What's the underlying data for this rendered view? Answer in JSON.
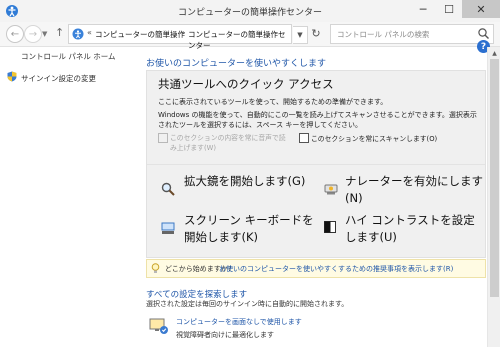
{
  "window": {
    "title": "コンピューターの簡単操作センター",
    "min_glyph": "─",
    "max_glyph": "☐",
    "close_glyph": "✕"
  },
  "nav": {
    "back_glyph": "←",
    "forward_glyph": "→",
    "history_glyph": "▼",
    "up_glyph": "↑",
    "breadcrumb_lead": "«",
    "breadcrumb": [
      "コンピューターの簡単操作",
      "コンピューターの簡単操作センター"
    ],
    "breadcrumb_sep": "›",
    "dropdown_glyph": "▼",
    "refresh_glyph": "↻",
    "search_placeholder": "コントロール パネルの検索"
  },
  "help_glyph": "?",
  "sidebar": {
    "items": [
      {
        "label": "コントロール パネル ホーム"
      },
      {
        "label": "サインイン設定の変更"
      }
    ]
  },
  "main": {
    "heading": "お使いのコンピューターを使いやすくします",
    "quick": {
      "heading": "共通ツールへのクイック アクセス",
      "description": "ここに表示されているツールを使って、開始するための準備ができます。",
      "body": "Windows の機能を使って、自動的にこの一覧を読み上げてスキャンさせることができます。選択表示されたツールを選択するには、スペース キーを押してください。",
      "checkbox_read_label": "このセクションの内容を常に音声で読み上げます(W)",
      "checkbox_scan_label": "このセクションを常にスキャンします(O)",
      "tools": [
        {
          "label": "拡大鏡を開始します(G)"
        },
        {
          "label": "ナレーターを有効にします(N)"
        },
        {
          "label": "スクリーン キーボードを開始します(K)"
        },
        {
          "label": "ハイ コントラストを設定します(U)"
        }
      ]
    },
    "info": {
      "prompt": "どこから始めますか?",
      "link": "お使いのコンピューターを使いやすくするための推奨事項を表示します(R)"
    },
    "explore": {
      "heading": "すべての設定を探索します",
      "description": "選択された設定は毎回のサインイン時に自動的に開始されます。",
      "items": [
        {
          "link": "コンピューターを画面なしで使用します",
          "sub": "視覚障碍者向けに最適化します"
        }
      ]
    }
  },
  "colors": {
    "link": "#1f56a8",
    "panel": "#f0f0f0",
    "infobar": "#fffbe3"
  }
}
